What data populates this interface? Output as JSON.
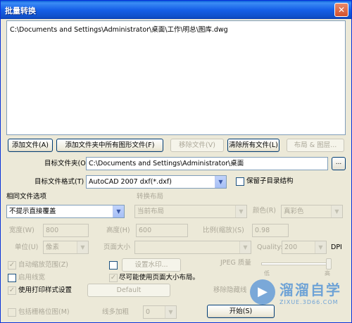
{
  "window": {
    "title": "批量转换",
    "close_glyph": "✕"
  },
  "files": [
    "C:\\Documents and Settings\\Administrator\\桌面\\工作\\明总\\图库.dwg"
  ],
  "buttons": {
    "add_file": "添加文件(A)",
    "add_folder_all": "添加文件夹中所有图形文件(F)",
    "remove_file": "移除文件(V)",
    "clear_all": "清除所有文件(L)",
    "layout_layers": "布局 & 图层...",
    "browse": "...",
    "watermark": "设置水印...",
    "default": "Default",
    "start": "开始(S)"
  },
  "target_folder": {
    "label": "目标文件夹(O)",
    "value": "C:\\Documents and Settings\\Administrator\\桌面"
  },
  "target_format": {
    "label": "目标文件格式(T)",
    "value": "AutoCAD 2007 dxf(*.dxf)"
  },
  "keep_dir": {
    "label": "保留子目录结构",
    "checked": false
  },
  "same_file": {
    "label": "相同文件选项",
    "value": "不提示直接覆盖"
  },
  "convert_layout": {
    "label": "转换布局",
    "value": "当前布局"
  },
  "color": {
    "label": "颜色(R)",
    "value": "真彩色"
  },
  "width": {
    "label": "宽度(W)",
    "value": "800"
  },
  "height": {
    "label": "高度(H)",
    "value": "600"
  },
  "ratio": {
    "label": "比例(缩放)(S)",
    "value": "0.98"
  },
  "unit": {
    "label": "单位(U)",
    "value": "像素"
  },
  "page_size": {
    "label": "页面大小",
    "value": ""
  },
  "quality": {
    "label": "Quality:",
    "value": "200",
    "unit": "DPI"
  },
  "jpeg": {
    "label": "JPEG 质量",
    "low": "低",
    "high": "高",
    "level": 1.0
  },
  "auto_zoom": {
    "label": "自动缩放范围(Z)",
    "checked": true
  },
  "line_width": {
    "label": "启用线宽",
    "checked": false
  },
  "print_style": {
    "label": "使用打印样式设置",
    "checked": true
  },
  "watermark_chk": {
    "checked": false
  },
  "use_page_size": {
    "label": "尽可能使用页面大小布局。",
    "checked": true
  },
  "hidden_lines": {
    "label": "移除隐藏线"
  },
  "include_raster": {
    "label": "包括栅格位图(M)",
    "checked": false
  },
  "thread": {
    "label": "线多加粗",
    "value": "0"
  },
  "watermark_logo": {
    "main": "溜溜自学",
    "sub": "ZIXUE.3D66.COM",
    "glyph": "▶"
  }
}
